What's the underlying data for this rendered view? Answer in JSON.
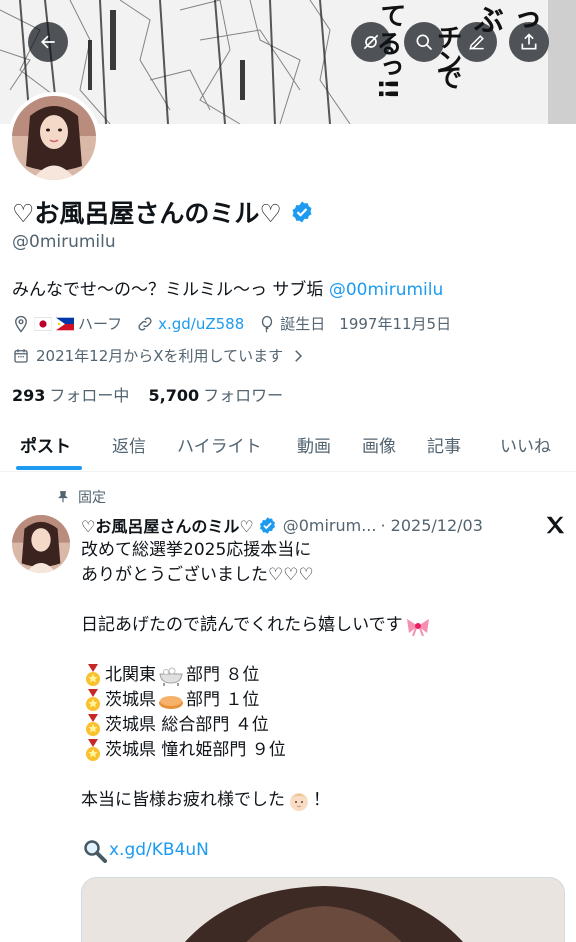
{
  "banner": {
    "manga_text": [
      "っ",
      "ぶ",
      "チン",
      "で",
      "て",
      "るっ!!"
    ]
  },
  "profile": {
    "name": "♡お風呂屋さんのミル♡",
    "handle": "@0mirumilu",
    "bio_text": "みんなでせ〜の〜？ミルミル〜っ サブ垢",
    "bio_link": "@00mirumilu",
    "location": "ハーフ",
    "website": "x.gd/uZ588",
    "birthday_label": "誕生日",
    "birthday": "1997年11月5日",
    "joined": "2021年12月からXを利用しています",
    "following_count": "293",
    "following_label": "フォロー中",
    "followers_count": "5,700",
    "followers_label": "フォロワー"
  },
  "tabs": [
    "ポスト",
    "返信",
    "ハイライト",
    "動画",
    "画像",
    "記事",
    "いいね"
  ],
  "post": {
    "pinned_label": "固定",
    "author_name": "♡お風呂屋さんのミル♡",
    "author_handle": "@0mirum...",
    "date": "· 2025/12/03",
    "lines": {
      "l1": "改めて総選挙2025応援本当に",
      "l2": "ありがとうございました♡♡♡",
      "l3": "日記あげたので読んでくれたら嬉しいです",
      "r1a": "北関東",
      "r1b": "部門 ８位",
      "r2a": "茨城県",
      "r2b": "部門 １位",
      "r3": "茨城県 総合部門 ４位",
      "r4": "茨城県 憧れ姫部門 ９位",
      "l4": "本当に皆様お疲れ様でした",
      "l4b": "！",
      "link": "x.gd/KB4uN"
    }
  },
  "colors": {
    "accent": "#1d9bf0",
    "secondary_text": "#536471",
    "verified": "#1d9bf0"
  },
  "icons": {
    "back": "arrow-left-icon",
    "mute": "eye-off-icon",
    "search": "search-icon",
    "edit": "pencil-icon",
    "share": "share-icon",
    "verified": "verified-badge-icon",
    "location": "location-pin-icon",
    "link": "link-icon",
    "birthday": "balloon-icon",
    "calendar": "calendar-icon",
    "pin": "pin-icon",
    "x_logo": "x-logo-icon",
    "search_emoji": "magnifier-emoji-icon"
  }
}
